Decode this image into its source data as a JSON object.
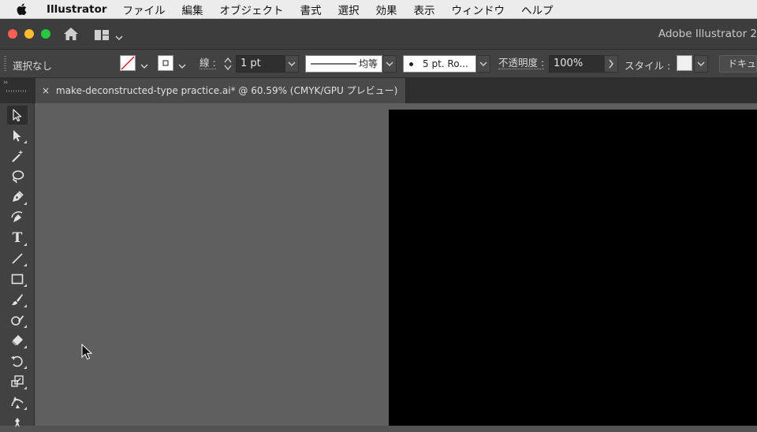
{
  "menubar": {
    "app_name": "Illustrator",
    "items": [
      "ファイル",
      "編集",
      "オブジェクト",
      "書式",
      "選択",
      "効果",
      "表示",
      "ウィンドウ",
      "ヘルプ"
    ]
  },
  "titlebar": {
    "title": "Adobe Illustrator 2"
  },
  "controlbar": {
    "selection": "選択なし",
    "stroke_label": "線 :",
    "stroke_weight": "1 pt",
    "line_style": "均等",
    "brush_profile": "5 pt. Ro...",
    "opacity_label": "不透明度 :",
    "opacity_value": "100%",
    "style_label": "スタイル :",
    "doc_button": "ドキュ"
  },
  "document_tab": {
    "close_glyph": "×",
    "name": "make-deconstructed-type  practice.ai* @ 60.59% (CMYK/GPU プレビュー)"
  },
  "toolbar": {
    "collapse_glyph": "››",
    "type_tool_glyph": "T"
  },
  "colors": {
    "menubar_bg": "#ececec",
    "ui_dark": "#424242",
    "canvas": "#5f5f5f",
    "artboard": "#000000",
    "close": "#fe5f57",
    "minimize": "#febc2e",
    "zoom": "#28c840"
  },
  "icons": [
    "apple-icon",
    "home-icon",
    "workspace-icon",
    "selection-tool-icon",
    "direct-selection-tool-icon",
    "magic-wand-icon",
    "lasso-icon",
    "pen-icon",
    "curvature-icon",
    "type-tool-icon",
    "line-tool-icon",
    "rectangle-tool-icon",
    "paintbrush-icon",
    "shaper-icon",
    "eraser-icon",
    "rotate-icon",
    "scale-icon",
    "width-tool-icon",
    "puppet-warp-icon"
  ]
}
